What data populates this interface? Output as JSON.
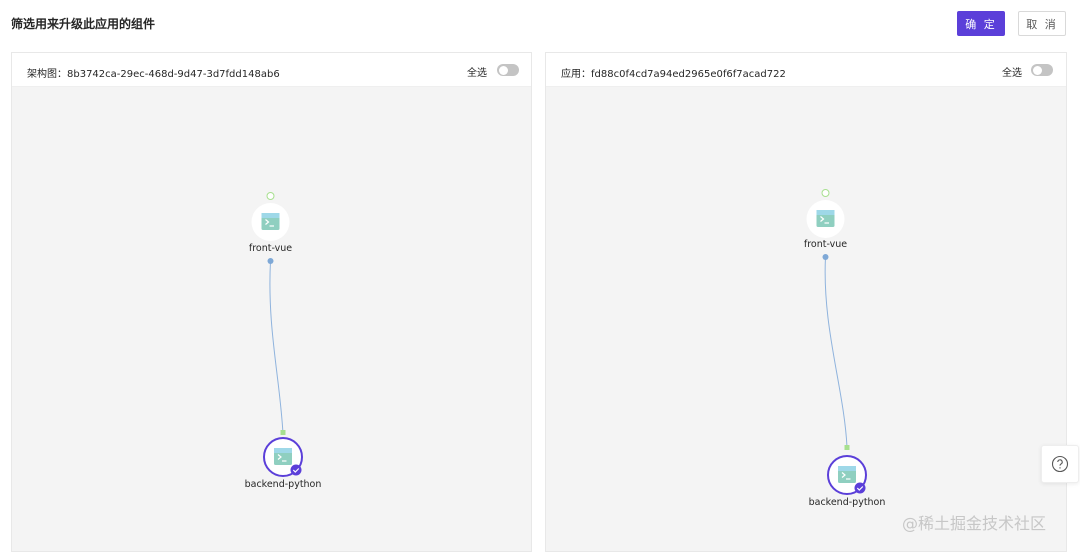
{
  "header": {
    "title": "筛选用来升级此应用的组件",
    "confirm_label": "确 定",
    "cancel_label": "取 消"
  },
  "colors": {
    "primary": "#5b3fd9",
    "edge": "#8fb3dd",
    "port_green": "#a7e08f",
    "node_icon": "#8fcfc0"
  },
  "left_panel": {
    "title": "架构图：8b3742ca-29ec-468d-9d47-3d7fdd148ab6",
    "select_all_label": "全选",
    "select_all_on": false,
    "nodes": [
      {
        "name": "front-vue",
        "icon": "terminal-icon",
        "selected": false
      },
      {
        "name": "backend-python",
        "icon": "terminal-icon",
        "selected": true
      }
    ]
  },
  "right_panel": {
    "title": "应用：fd88c0f4cd7a94ed2965e0f6f7acad722",
    "select_all_label": "全选",
    "select_all_on": false,
    "nodes": [
      {
        "name": "front-vue",
        "icon": "terminal-icon",
        "selected": false
      },
      {
        "name": "backend-python",
        "icon": "terminal-icon",
        "selected": true
      }
    ]
  },
  "help": {
    "icon": "question-icon"
  },
  "watermark": "@稀土掘金技术社区"
}
